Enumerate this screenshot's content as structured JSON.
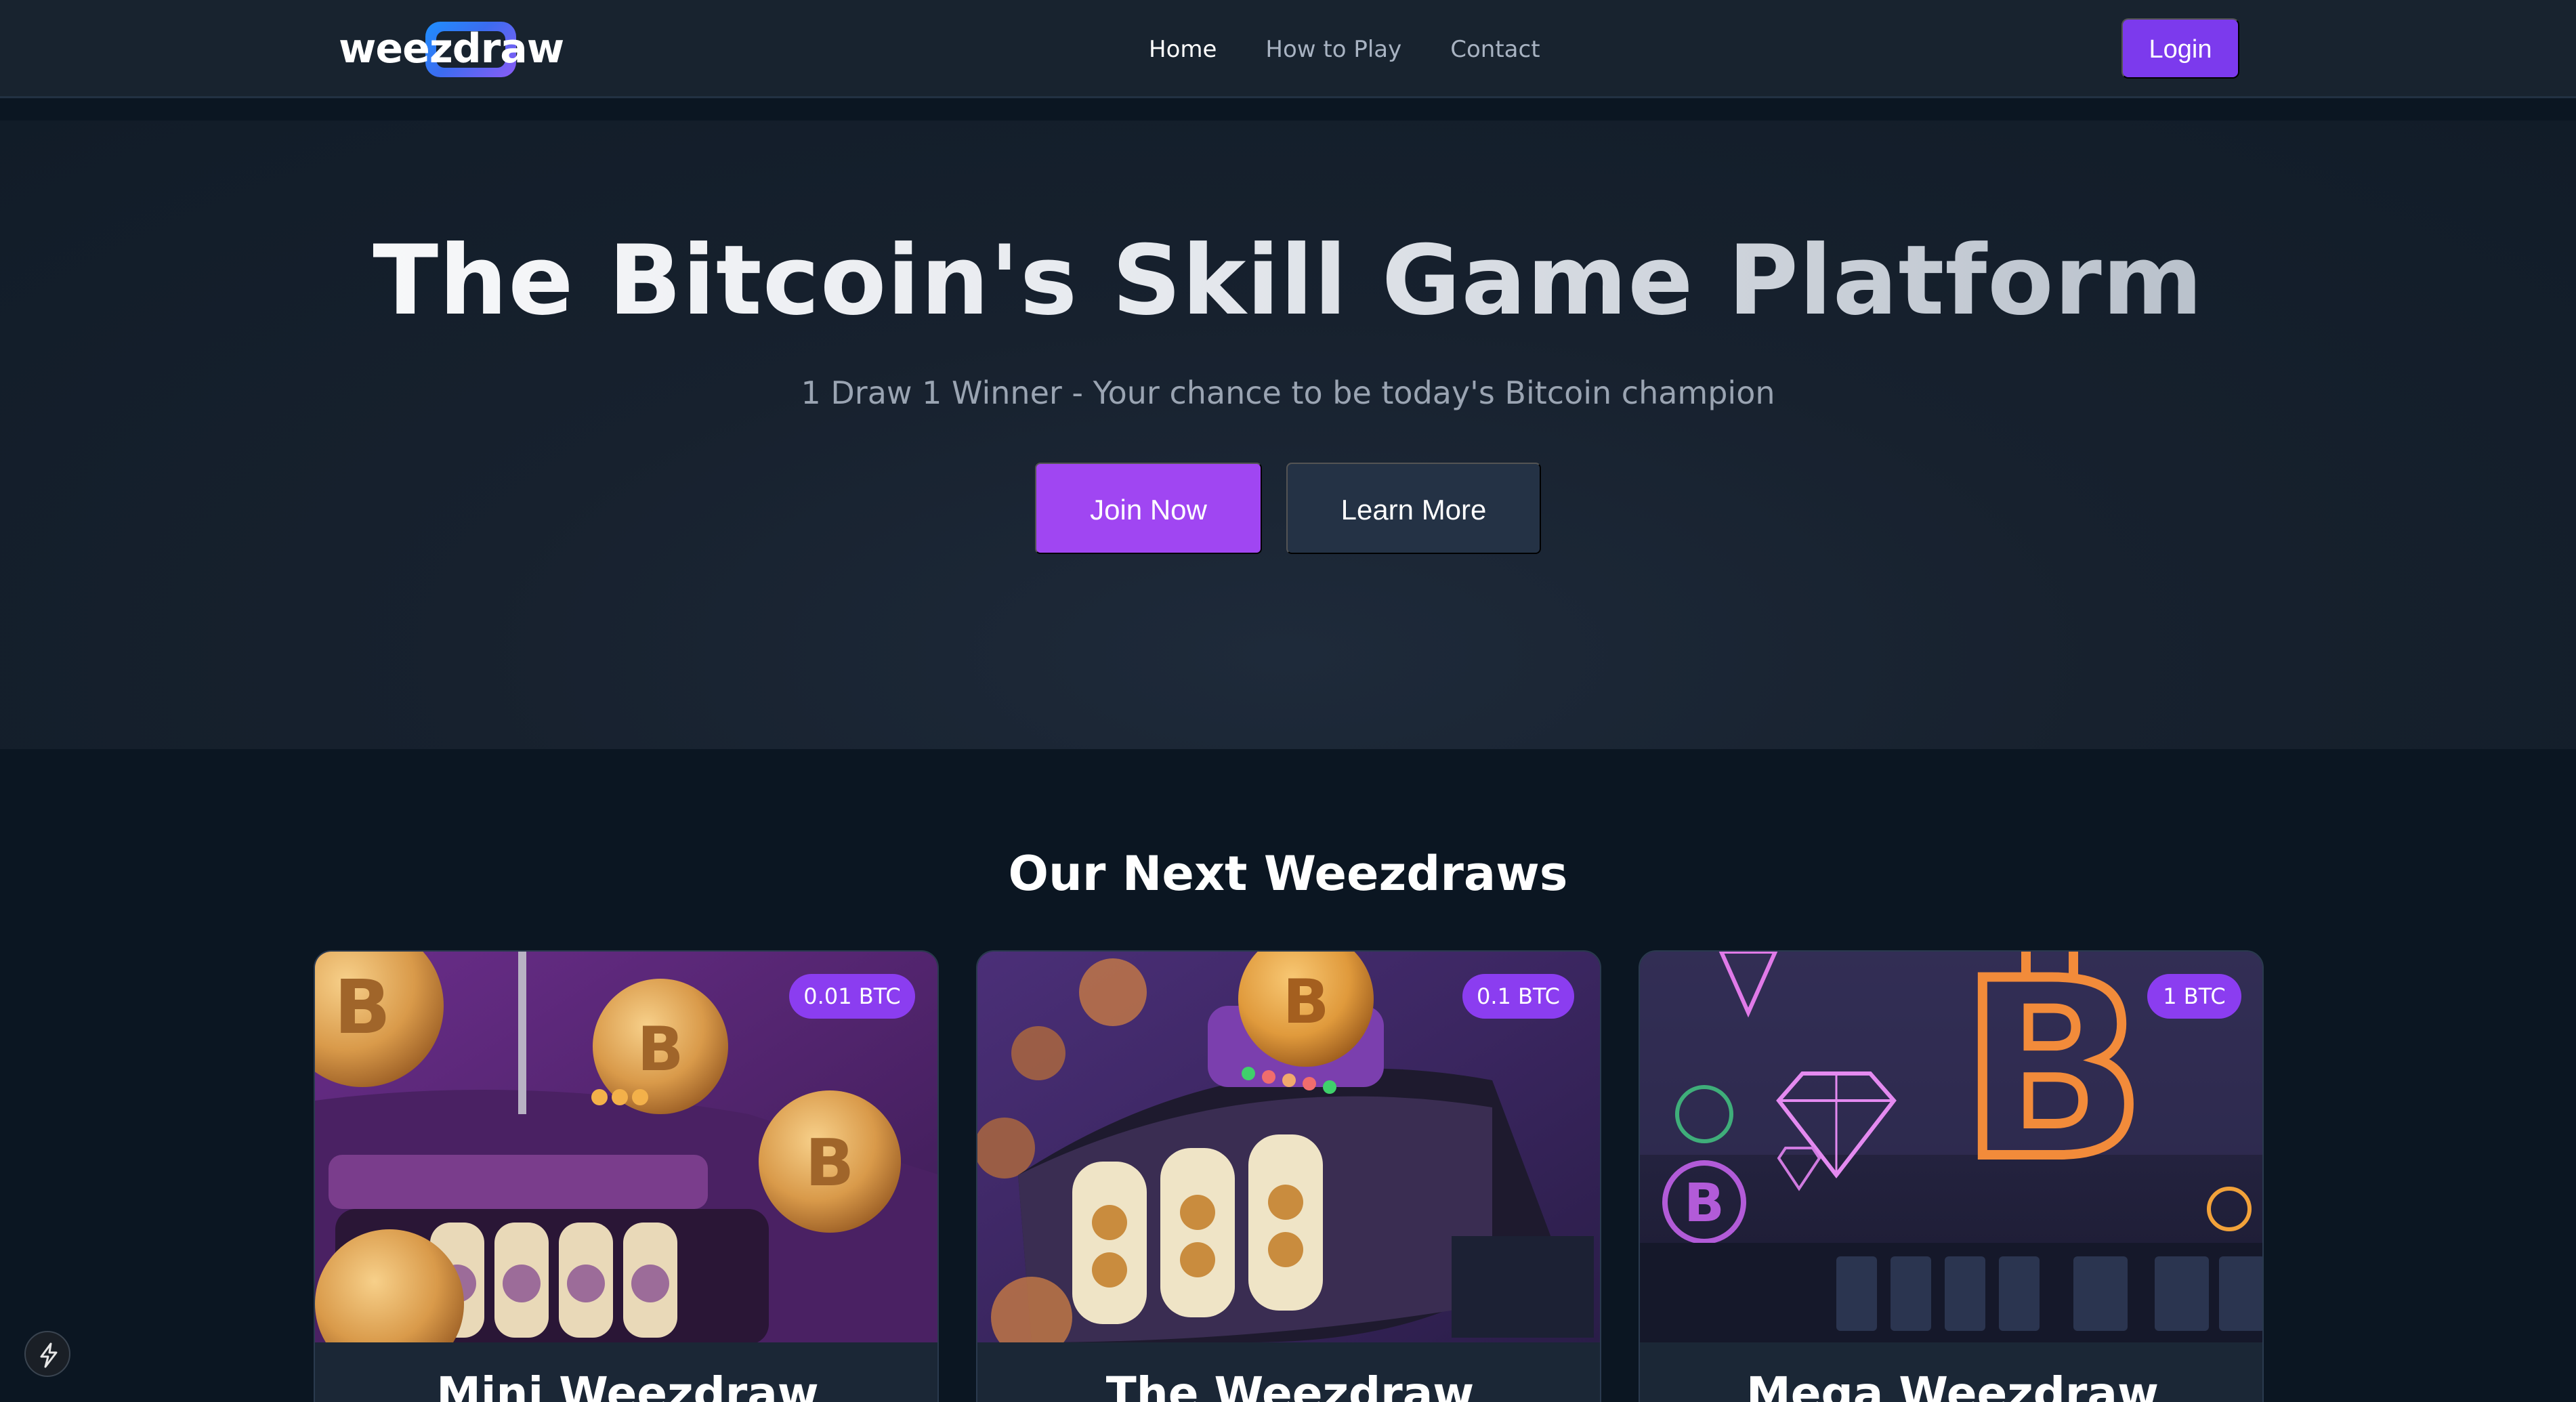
{
  "nav": {
    "logo_text": "weezdraw",
    "links": [
      {
        "label": "Home",
        "active": true
      },
      {
        "label": "How to Play",
        "active": false
      },
      {
        "label": "Contact",
        "active": false
      }
    ],
    "login_label": "Login"
  },
  "hero": {
    "title": "The Bitcoin's Skill Game Platform",
    "subtitle": "1 Draw 1 Winner - Your chance to be today's Bitcoin champion",
    "join_label": "Join Now",
    "learn_label": "Learn More"
  },
  "section": {
    "title": "Our Next Weezdraws"
  },
  "cards": [
    {
      "name": "Mini Weezdraw",
      "prize": "0.01 BTC",
      "image": "purple slot machine with bitcoin coins"
    },
    {
      "name": "The Weezdraw",
      "prize": "0.1 BTC",
      "image": "slot reels with bitcoin coin"
    },
    {
      "name": "Mega Weezdraw",
      "prize": "1 BTC",
      "image": "neon casino with diamond and bitcoin sign"
    }
  ],
  "colors": {
    "accent": "#7c3aed",
    "join_button": "#a046f2",
    "secondary_button": "#243245",
    "background": "#0b1622",
    "nav": "#18232f"
  },
  "icons": {
    "dev_badge": "lightning-bolt-icon"
  }
}
